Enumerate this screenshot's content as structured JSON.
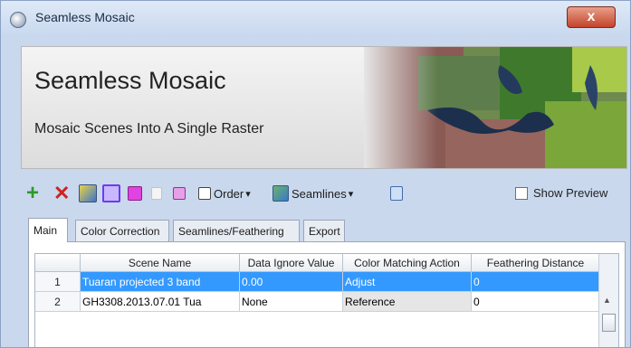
{
  "window": {
    "title": "Seamless Mosaic",
    "close_glyph": "x"
  },
  "banner": {
    "title": "Seamless Mosaic",
    "subtitle": "Mosaic Scenes Into A Single Raster"
  },
  "toolbar": {
    "order_label": "Order",
    "seamlines_label": "Seamlines",
    "dropdown_glyph": "▾",
    "show_preview_label": "Show Preview",
    "show_preview_checked": false,
    "icons": [
      "add-icon",
      "remove-icon",
      "raster-icon",
      "footprint-icon",
      "highlight-icon",
      "copy-icon",
      "duplicate-icon",
      "order-icon",
      "seamlines-icon",
      "grid-icon"
    ]
  },
  "tabs": [
    {
      "label": "Main",
      "active": true
    },
    {
      "label": "Color Correction",
      "active": false
    },
    {
      "label": "Seamlines/Feathering",
      "active": false
    },
    {
      "label": "Export",
      "active": false
    }
  ],
  "grid": {
    "columns": [
      "Scene Name",
      "Data Ignore Value",
      "Color Matching Action",
      "Feathering Distance"
    ],
    "rows": [
      {
        "num": "1",
        "scene": "Tuaran projected 3 band",
        "ignore": "0.00",
        "action": "Adjust",
        "feather": "0",
        "selected": true
      },
      {
        "num": "2",
        "scene": "GH3308.2013.07.01 Tua",
        "ignore": "None",
        "action": "Reference",
        "feather": "0",
        "selected": false
      }
    ]
  },
  "colors": {
    "selection": "#3399ff",
    "add_green": "#2a9a2a",
    "remove_red": "#cc2222"
  }
}
